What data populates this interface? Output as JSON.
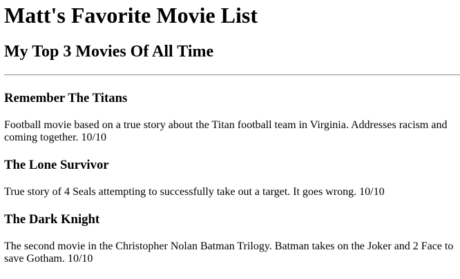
{
  "page": {
    "title": "Matt's Favorite Movie List",
    "subtitle": "My Top 3 Movies Of All Time"
  },
  "movies": [
    {
      "title": "Remember The Titans",
      "description": "Football movie based on a true story about the Titan football team in Virginia. Addresses racism and coming together. 10/10"
    },
    {
      "title": "The Lone Survivor",
      "description": "True story of 4 Seals attempting to successfully take out a target. It goes wrong. 10/10"
    },
    {
      "title": "The Dark Knight",
      "description": "The second movie in the Christopher Nolan Batman Trilogy. Batman takes on the Joker and 2 Face to save Gotham. 10/10"
    }
  ]
}
